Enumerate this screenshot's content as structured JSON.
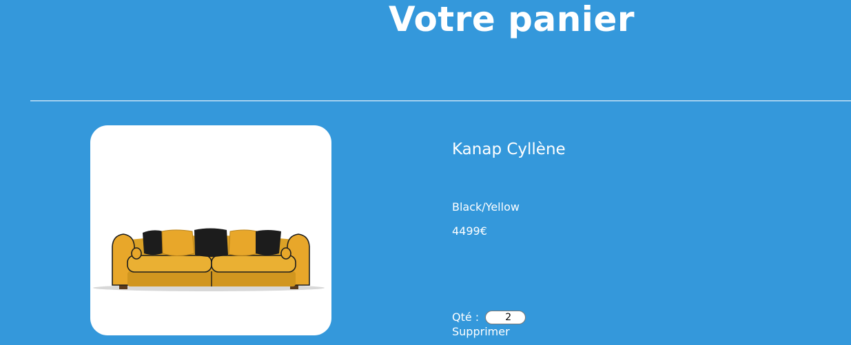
{
  "page": {
    "title": "Votre panier"
  },
  "cart": {
    "items": [
      {
        "name": "Kanap Cyllène",
        "color": "Black/Yellow",
        "price": "4499€",
        "quantity_label": "Qté :",
        "quantity_value": "2",
        "delete_label": "Supprimer",
        "image_icon": "sofa-image"
      }
    ]
  },
  "colors": {
    "background": "#3498db",
    "text": "#ffffff",
    "image_frame": "#ffffff",
    "sofa_fabric": "#e8a72a",
    "pillow_black": "#1c1c1c"
  }
}
